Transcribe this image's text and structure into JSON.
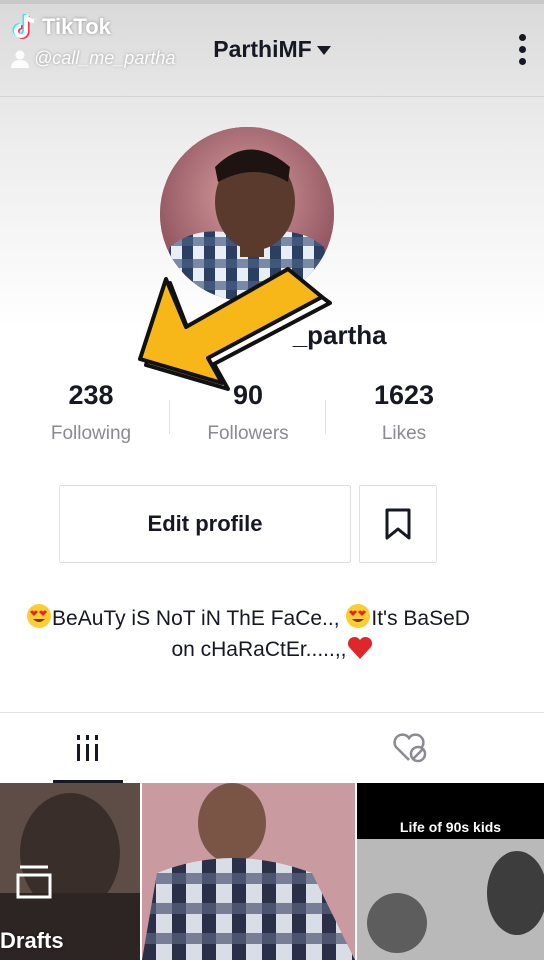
{
  "watermark": {
    "logo_text": "TikTok",
    "handle": "@call_me_partha"
  },
  "header": {
    "title": "ParthiMF",
    "menu_icon": "more-vertical-icon",
    "caret_icon": "caret-down-icon"
  },
  "profile": {
    "username": "@call_me_partha",
    "username_visible_start": "@",
    "username_visible_end": "_partha",
    "stats": [
      {
        "value": "238",
        "label": "Following"
      },
      {
        "value": "90",
        "label": "Followers"
      },
      {
        "value": "1623",
        "label": "Likes"
      }
    ],
    "edit_label": "Edit profile",
    "bookmark_icon": "bookmark-icon",
    "bio_line1": "BeAuTy iS NoT iN ThE FaCe.., ",
    "bio_line1b": "It's BaSeD",
    "bio_line2": "on cHaRaCtEr.....,,"
  },
  "tabs": [
    {
      "name": "videos",
      "icon": "grid-icon",
      "active": true
    },
    {
      "name": "liked",
      "icon": "heart-hidden-icon",
      "active": false
    }
  ],
  "grid": {
    "drafts_label": "Drafts",
    "caption_3": "Life of 90s kids"
  },
  "colors": {
    "text": "#161823",
    "muted": "#8a8b91",
    "arrow_fill": "#f7b718",
    "heart": "#e0252b",
    "emoji_face": "#ffcc33"
  }
}
